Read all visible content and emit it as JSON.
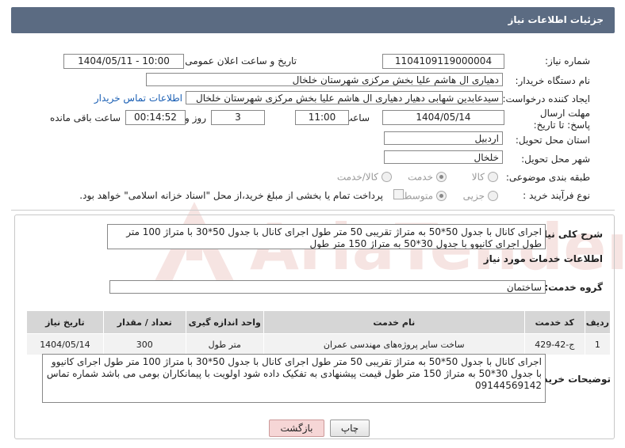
{
  "header": {
    "title": "جزئیات اطلاعات نیاز"
  },
  "fields": {
    "need_number_label": "شماره نیاز:",
    "need_number": "1104109119000004",
    "announce_label": "تاریخ و ساعت اعلان عمومی:",
    "announce_value": "1404/05/11 - 10:00",
    "buyer_org_label": "نام دستگاه خریدار:",
    "buyer_org": "دهیاری ال هاشم علیا بخش مرکزی شهرستان خلخال",
    "creator_label": "ایجاد کننده درخواست:",
    "creator": "سیدعابدین شهابی دهیار دهیاری ال هاشم علیا بخش مرکزی شهرستان خلخال",
    "contact_link": "اطلاعات تماس خریدار",
    "deadline_label": "مهلت ارسال پاسخ: تا تاریخ:",
    "deadline_date": "1404/05/14",
    "time_label": "ساعت",
    "deadline_time": "11:00",
    "days_value": "3",
    "days_label": "روز و",
    "remaining_time": "00:14:52",
    "remaining_label": "ساعت باقی مانده",
    "province_label": "استان محل تحویل:",
    "province": "اردبیل",
    "city_label": "شهر محل تحویل:",
    "city": "خلخال",
    "category_label": "طبقه بندی موضوعی:",
    "category_options": [
      "کالا",
      "خدمت",
      "کالا/خدمت"
    ],
    "category_selected": "خدمت",
    "process_label": "نوع فرآیند خرید :",
    "process_options": [
      "جزیی",
      "متوسط"
    ],
    "process_selected": "متوسط",
    "payment_note": "پرداخت تمام یا بخشی از مبلغ خرید،از محل \"اسناد خزانه اسلامی\" خواهد بود."
  },
  "summary": {
    "label": "شرح کلی نیاز:",
    "text": "اجرای کانال با جدول 50*50 به متراژ تقریبی 50 متر طول اجرای کانال با جدول 50*30 با متراژ 100 متر طول اجرای کانیوو با جدول 30*50 به متراژ  150 متر طول"
  },
  "services": {
    "section_title": "اطلاعات خدمات مورد نیاز",
    "group_label": "گروه خدمت:",
    "group_value": "ساختمان",
    "columns": [
      "ردیف",
      "کد خدمت",
      "نام خدمت",
      "واحد اندازه گیری",
      "تعداد / مقدار",
      "تاریخ نیاز"
    ],
    "rows": [
      [
        "1",
        "ج-42-429",
        "ساخت سایر پروژه‌های مهندسی عمران",
        "متر طول",
        "300",
        "1404/05/14"
      ]
    ]
  },
  "buyer_notes": {
    "label": "توضیحات خریدار:",
    "text": "اجرای کانال با جدول 50*50 به متراژ تقریبی 50 متر طول اجرای کانال با جدول 50*30 با متراژ 100 متر طول اجرای کانیوو با جدول 30*50 به متراژ  150 متر طول قیمت پیشنهادی به تفکیک  داده شود اولویت با پیمانکاران بومی  می باشد شماره تماس 09144569142"
  },
  "buttons": {
    "print": "چاپ",
    "back": "بازگشت"
  },
  "watermark": {
    "text": "AriaTender.net",
    "color": "#c0392b"
  }
}
